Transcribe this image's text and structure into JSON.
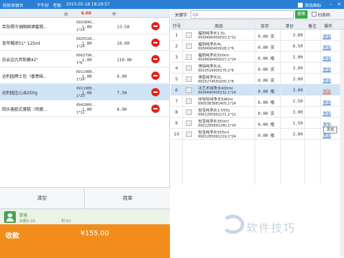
{
  "title_bar": {
    "app_name": "轻松收银台",
    "shift": "下午好",
    "user": "老板",
    "datetime": "2015-05-18 18:29:57",
    "product_icon_label": "商品图标"
  },
  "cart": {
    "header_prefix": "共",
    "total_amount": "6.00",
    "header_unit": "件",
    "items": [
      {
        "name": "百加得冷调朗姆酒蜜桃...",
        "barcode": "6923840...",
        "spec": "1*24",
        "qty": "1.00",
        "price": "13.50"
      },
      {
        "name": "百年糊涂51° 125ml",
        "barcode": "6925526...",
        "spec": "1*24",
        "qty": "1.00",
        "price": "10.00"
      },
      {
        "name": "白云边九年陈酿42°",
        "barcode": "6902796...",
        "spec": "1*6",
        "qty": "1.00",
        "price": "110.00"
      },
      {
        "name": "达利园烤土包（香葱味...",
        "barcode": "6911988...",
        "spec": "1*24",
        "qty": "1.00",
        "price": "6.00"
      },
      {
        "name": "达利园注心派250g",
        "barcode": "6911988...",
        "spec": "1*20",
        "qty": "1.00",
        "price": "7.50"
      },
      {
        "name": "回头客欧式蛋糕（鸡蛋...",
        "barcode": "6942886...",
        "spec": "1*12",
        "qty": "1.00",
        "price": "8.00"
      }
    ]
  },
  "actions": {
    "clear_label": "清空",
    "hold_label": "挂单"
  },
  "member": {
    "name": "散客",
    "balance_label": "余额0.00",
    "points_label": "积分0"
  },
  "payment": {
    "label": "收款",
    "amount": "¥155.00"
  },
  "search": {
    "keyword_label": "关键字",
    "value": "cjs",
    "button_label": "搜索",
    "scan_label": "扫条码"
  },
  "grid": {
    "headers": {
      "no": "行号",
      "product": "商品",
      "stock": "库存",
      "unit_price": "单价",
      "note": "备注",
      "action": "操作"
    },
    "rows": [
      {
        "no": "1",
        "name": "福旭纯净水1.5L",
        "code": "6934690400010,1*12",
        "stock": "0.00 支",
        "price": "3.00",
        "action": "添加"
      },
      {
        "name": "福旭纯净水4L",
        "no": "2",
        "code": "6934690400028,1*6",
        "stock": "0.00 支",
        "price": "6.50",
        "action": "添加"
      },
      {
        "no": "3",
        "name": "福旭纯净水550ml",
        "code": "6934690400027,1*24",
        "stock": "0.00 瓶",
        "price": "1.00",
        "action": "添加"
      },
      {
        "no": "4",
        "name": "滑铂纯净水2L",
        "code": "6910516900176,1*8",
        "stock": "0.00 支",
        "price": "3.00",
        "action": "添加"
      },
      {
        "no": "5",
        "name": "滑蓝纯净水2L",
        "code": "6925274550200,1*8",
        "stock": "0.00 支",
        "price": "3.00",
        "action": "添加"
      },
      {
        "no": "6",
        "name": "冰艺术纯净水400ml",
        "code": "6934690400232,1*24",
        "stock": "0.00 瓶",
        "price": "3.00",
        "action": "添加"
      },
      {
        "no": "7",
        "name": "哇哈哈纯净水596ml",
        "code": "6900383881405,1*24",
        "stock": "0.00 瓶",
        "price": "1.50",
        "action": "添加"
      },
      {
        "no": "8",
        "name": "怡宝纯净水1.555L",
        "code": "6901285991271,1*12",
        "stock": "0.00 支",
        "price": "3.00",
        "action": "添加"
      },
      {
        "no": "9",
        "name": "怡宝纯净水350ml",
        "code": "6901285891240,1*24",
        "stock": "0.00 瓶",
        "price": "1.50",
        "action": "添加"
      },
      {
        "no": "10",
        "name": "怡宝纯净水555ml",
        "code": "6901285991219,1*24",
        "stock": "0.00 瓶",
        "price": "2.00",
        "action": "添加"
      }
    ],
    "tooltip": "添加"
  },
  "watermark": "软件技巧",
  "colors": {
    "title_bar": "#2a7fd4",
    "pay_bar": "#f28d1c",
    "delete": "#e0221b",
    "search_button": "#36a846",
    "member_bg": "#eaf3e6"
  }
}
